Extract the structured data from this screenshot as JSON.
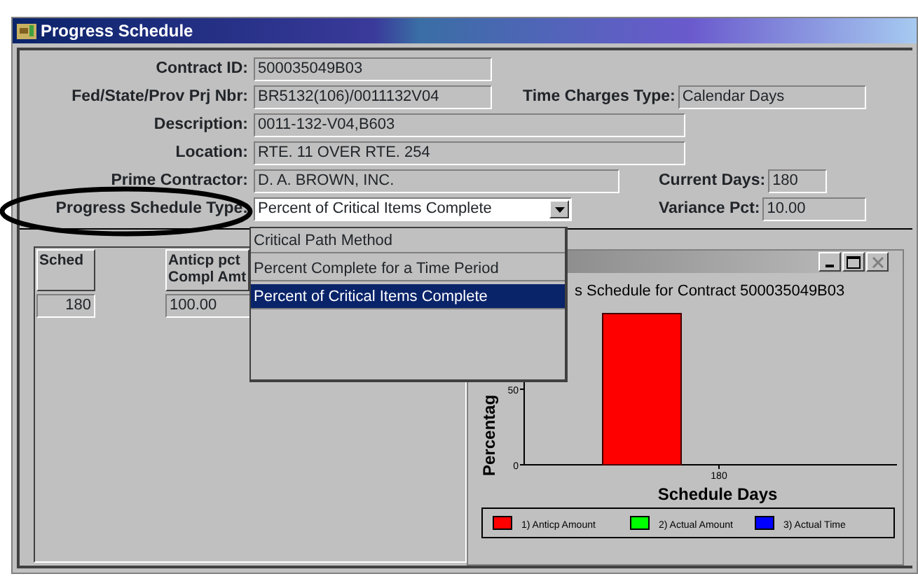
{
  "window": {
    "title": "Progress Schedule"
  },
  "form": {
    "rows": [
      {
        "label": "Contract ID:",
        "value": "500035049B03",
        "kind": "text"
      },
      {
        "label": "Fed/State/Prov Prj Nbr:",
        "value": "BR5132(106)/0011132V04",
        "kind": "text",
        "right": {
          "label": "Time Charges Type:",
          "value": "Calendar Days"
        }
      },
      {
        "label": "Description:",
        "value": "0011-132-V04,B603",
        "kind": "text"
      },
      {
        "label": "Location:",
        "value": "RTE. 11 OVER RTE. 254",
        "kind": "text"
      },
      {
        "label": "Prime Contractor:",
        "value": "D. A. BROWN, INC.",
        "kind": "text",
        "right": {
          "label": "Current Days:",
          "value": "180"
        }
      },
      {
        "label": "Progress Schedule Type:",
        "value": "Percent of Critical Items Complete",
        "kind": "dropdown",
        "right": {
          "label": "Variance Pct:",
          "value": "10.00"
        }
      }
    ]
  },
  "dropdown_options": [
    {
      "label": "Critical Path Method",
      "selected": false
    },
    {
      "label": "Percent Complete for a Time Period",
      "selected": false
    },
    {
      "label": "Percent of Critical Items Complete",
      "selected": true
    }
  ],
  "schedule_table": {
    "columns": [
      "Sched",
      "Anticp pct Compl Amt"
    ],
    "rows": [
      [
        "180",
        "100.00"
      ]
    ]
  },
  "chart_window": {
    "chart_data": {
      "type": "bar",
      "title": "s Schedule for Contract  500035049B03",
      "xlabel": "Schedule Days",
      "ylabel": "Percentag",
      "categories": [
        "180"
      ],
      "ylim": [
        0,
        100
      ],
      "yticks": [
        0,
        50
      ],
      "series": [
        {
          "name": "1) Anticp Amount",
          "color": "#ff0000",
          "values": [
            100
          ]
        },
        {
          "name": "2) Actual Amount",
          "color": "#00ff00",
          "values": [
            null
          ]
        },
        {
          "name": "3) Actual Time",
          "color": "#0000ff",
          "values": [
            null
          ]
        }
      ]
    }
  }
}
